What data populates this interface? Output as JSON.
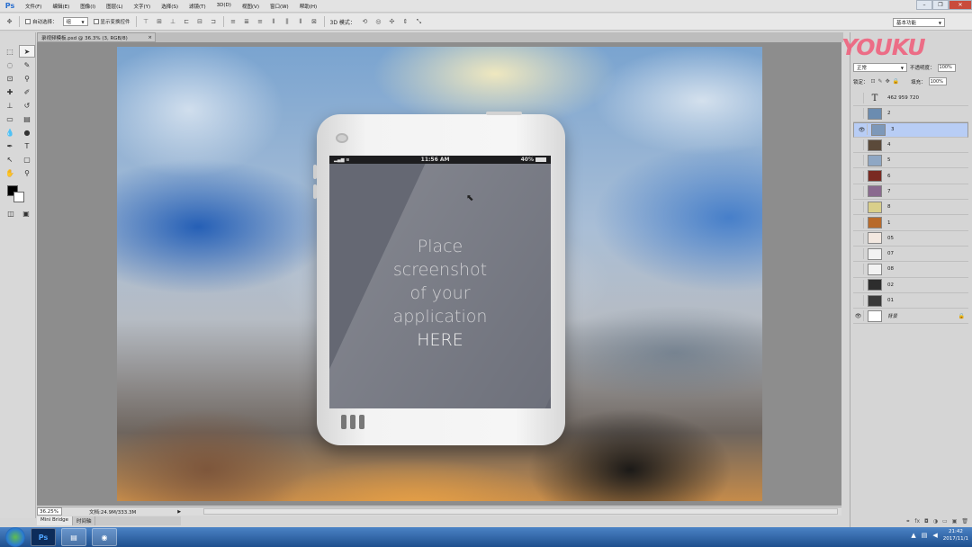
{
  "app": {
    "logo": "Ps"
  },
  "menu": [
    "文件(F)",
    "编辑(E)",
    "图像(I)",
    "图层(L)",
    "文字(Y)",
    "选择(S)",
    "滤镜(T)",
    "3D(D)",
    "视图(V)",
    "窗口(W)",
    "帮助(H)"
  ],
  "options": {
    "auto_select_label": "自动选择：",
    "auto_select_value": "组",
    "show_transform_label": "显示变换控件",
    "mode_label": "3D 模式：",
    "workspace": "基本功能"
  },
  "document": {
    "tab_title": "录视频模板.psd @ 36.3% (3, RGB/8)",
    "zoom": "36.25%",
    "doc_info": "文档:24.9M/333.3M"
  },
  "phone": {
    "status_time": "11:56 AM",
    "status_battery": "40%",
    "placeholder_lines": [
      "Place",
      "screenshot",
      "of your",
      "application"
    ],
    "placeholder_here": "HERE"
  },
  "bottom_tabs": [
    "Mini Bridge",
    "时间轴"
  ],
  "watermark": "YOUKU",
  "layers_panel": {
    "blend_mode": "正常",
    "opacity_label": "不透明度：",
    "opacity_value": "100%",
    "lock_label": "锁定：",
    "fill_label": "填充：",
    "fill_value": "100%",
    "layers": [
      {
        "name": "462 959 720",
        "type": "text",
        "visible": false,
        "selected": false,
        "thumb": "#ffffff"
      },
      {
        "name": "2",
        "visible": false,
        "selected": false,
        "thumb": "#6b8cb0"
      },
      {
        "name": "3",
        "visible": true,
        "selected": true,
        "thumb": "#7d98b9"
      },
      {
        "name": "4",
        "visible": false,
        "selected": false,
        "thumb": "#5b4a3a"
      },
      {
        "name": "5",
        "visible": false,
        "selected": false,
        "thumb": "#8fa7c4"
      },
      {
        "name": "6",
        "visible": false,
        "selected": false,
        "thumb": "#7a2a22"
      },
      {
        "name": "7",
        "visible": false,
        "selected": false,
        "thumb": "#8a6a8f"
      },
      {
        "name": "8",
        "visible": false,
        "selected": false,
        "thumb": "#d9cf8a"
      },
      {
        "name": "1",
        "visible": false,
        "selected": false,
        "thumb": "#b86a2a"
      },
      {
        "name": "05",
        "visible": false,
        "selected": false,
        "thumb": "#f3e8e0"
      },
      {
        "name": "07",
        "visible": false,
        "selected": false,
        "thumb": "#f2f2f2"
      },
      {
        "name": "08",
        "visible": false,
        "selected": false,
        "thumb": "#f2f2f2"
      },
      {
        "name": "02",
        "visible": false,
        "selected": false,
        "thumb": "#2d2d2d"
      },
      {
        "name": "01",
        "visible": false,
        "selected": false,
        "thumb": "#3a3a3a"
      },
      {
        "name": "背景",
        "visible": true,
        "selected": false,
        "locked": true,
        "thumb": "#ffffff"
      }
    ]
  },
  "taskbar": {
    "time": "21:42",
    "date": "2017/11/1"
  }
}
